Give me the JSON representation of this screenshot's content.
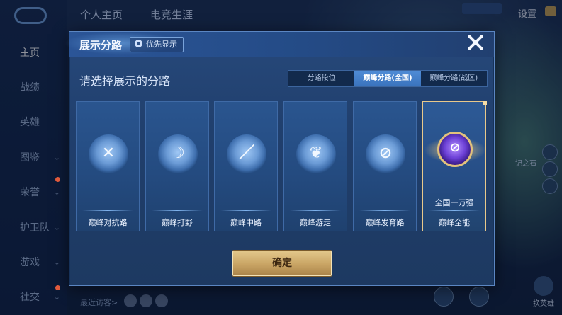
{
  "background": {
    "top_tabs": [
      "个人主页",
      "电竞生涯"
    ],
    "settings_label": "设置",
    "nav_items": [
      {
        "label": "主页",
        "active": true,
        "chevron": false
      },
      {
        "label": "战绩",
        "active": false,
        "chevron": false
      },
      {
        "label": "英雄",
        "active": false,
        "chevron": false
      },
      {
        "label": "图鉴",
        "active": false,
        "chevron": true
      },
      {
        "label": "荣誉",
        "active": false,
        "chevron": true
      },
      {
        "label": "护卫队",
        "active": false,
        "chevron": true
      },
      {
        "label": "游戏",
        "active": false,
        "chevron": true
      },
      {
        "label": "社交",
        "active": false,
        "chevron": true
      }
    ],
    "recent_visitors_label": "最近访客>",
    "side_label": "记之石",
    "change_hero_label": "换英雄"
  },
  "dialog": {
    "title": "展示分路",
    "priority_button": "优先显示",
    "subtitle": "请选择展示的分路",
    "segments": [
      {
        "label": "分路段位",
        "selected": false
      },
      {
        "label": "巅峰分路(全国)",
        "selected": true
      },
      {
        "label": "巅峰分路(战区)",
        "selected": false
      }
    ],
    "cards": [
      {
        "label": "巅峰对抗路",
        "icon": "crossed-swords-icon",
        "glyph": "✕",
        "selected": false
      },
      {
        "label": "巅峰打野",
        "icon": "dragon-icon",
        "glyph": "☽",
        "selected": false
      },
      {
        "label": "巅峰中路",
        "icon": "blade-slash-icon",
        "glyph": "／",
        "selected": false
      },
      {
        "label": "巅峰游走",
        "icon": "wings-icon",
        "glyph": "❦",
        "selected": false
      },
      {
        "label": "巅峰发育路",
        "icon": "crosshair-icon",
        "glyph": "⊘",
        "selected": false
      },
      {
        "label": "巅峰全能",
        "icon": "allround-medal-icon",
        "glyph": "⊘",
        "selected": true,
        "rank_text": "全国一万强"
      }
    ],
    "confirm_label": "确定"
  }
}
